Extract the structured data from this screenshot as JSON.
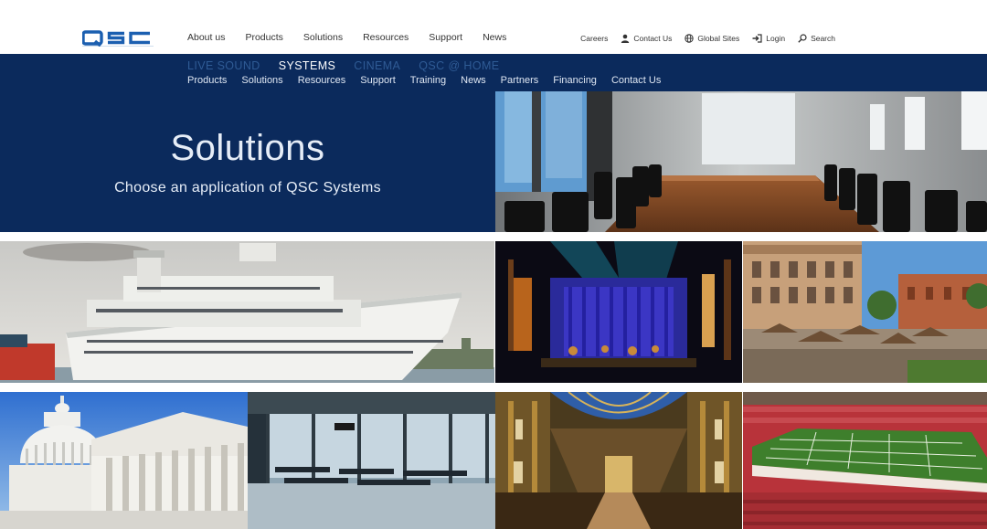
{
  "brand": {
    "logo_text": "QSC",
    "logo_color": "#1b5fb0"
  },
  "main_nav": [
    "About us",
    "Products",
    "Solutions",
    "Resources",
    "Support",
    "News"
  ],
  "utility_nav": {
    "careers": "Careers",
    "contact": "Contact Us",
    "global": "Global Sites",
    "login": "Login",
    "search": "Search"
  },
  "markets": [
    {
      "label": "LIVE SOUND",
      "active": false
    },
    {
      "label": "SYSTEMS",
      "active": true
    },
    {
      "label": "CINEMA",
      "active": false
    },
    {
      "label": "QSC @ HOME",
      "active": false
    }
  ],
  "sub_nav": [
    "Products",
    "Solutions",
    "Resources",
    "Support",
    "Training",
    "News",
    "Partners",
    "Financing",
    "Contact Us"
  ],
  "hero": {
    "title": "Solutions",
    "subtitle": "Choose an application of QSC Systems"
  },
  "tiles": {
    "corporate": "conference-room-photo",
    "cruise": "cruise-ship-photo",
    "performance": "concert-stage-photo",
    "campus": "campus-plaza-photo",
    "government": "capitol-building-photo",
    "transportation": "airport-terminal-photo",
    "worship": "cathedral-interior-photo",
    "stadium": "football-stadium-photo"
  },
  "colors": {
    "navy": "#0b2a5c",
    "market_inactive": "#2f5b95",
    "white": "#ffffff"
  }
}
